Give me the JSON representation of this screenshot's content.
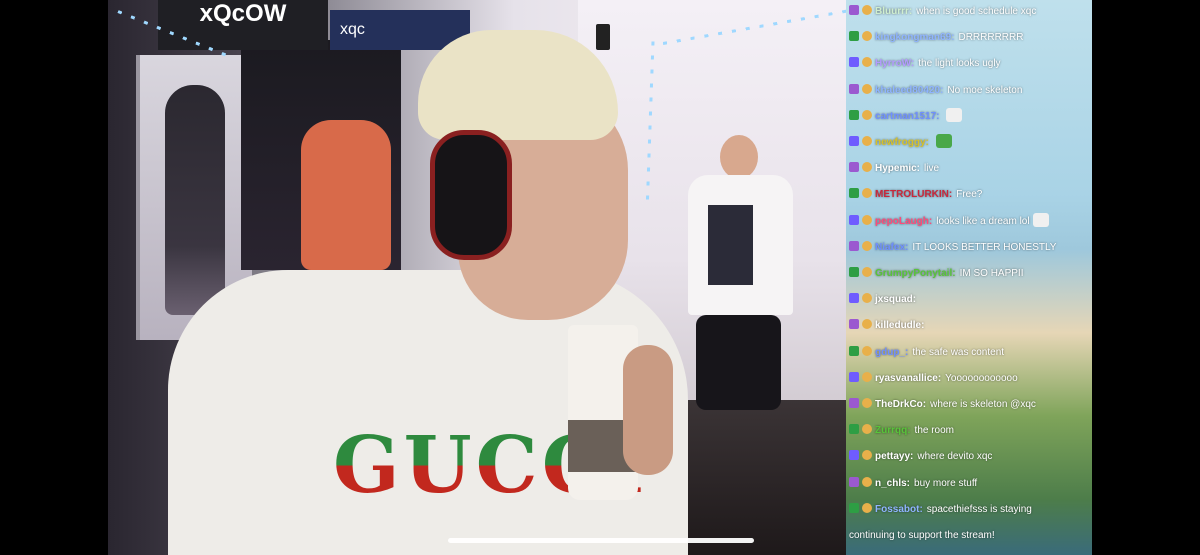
{
  "stream": {
    "banner_text": "xQcOW",
    "banner_text_2": "xqc",
    "shirt_text": "GUCCI"
  },
  "chat": {
    "messages": [
      {
        "user": "Bluurrr:",
        "text": "when is good schedule xqc",
        "user_color": "#cfeecf"
      },
      {
        "user": "kingkongman69:",
        "text": "DRRRRRRRR",
        "user_color": "#8fb4ff"
      },
      {
        "user": "HyrroW:",
        "text": "the light looks ugly",
        "user_color": "#b49cff"
      },
      {
        "user": "khaleed80420:",
        "text": "No moe skeleton",
        "user_color": "#8fb4ff"
      },
      {
        "user": "cartman1517:",
        "text": "",
        "user_color": "#6f8fff"
      },
      {
        "user": "newfroggy:",
        "text": "",
        "user_color": "#d7c22a"
      },
      {
        "user": "Hypemic:",
        "text": "live",
        "user_color": "#ffffff"
      },
      {
        "user": "METROLURKIN:",
        "text": "Free?",
        "user_color": "#c8283c"
      },
      {
        "user": "pepoLaugh:",
        "text": "looks like a dream lol",
        "user_color": "#ff4a7a"
      },
      {
        "user": "Niafex:",
        "text": "IT LOOKS BETTER HONESTLY",
        "user_color": "#6f8fff"
      },
      {
        "user": "GrumpyPonytail:",
        "text": "IM SO HAPPII",
        "user_color": "#58c43a"
      },
      {
        "user": "jxsquad:",
        "text": "",
        "user_color": "#ffffff"
      },
      {
        "user": "killedudle:",
        "text": "",
        "user_color": "#ffffff"
      },
      {
        "user": "gdup_:",
        "text": "the safe was content",
        "user_color": "#6f8fff"
      },
      {
        "user": "ryasvanallice:",
        "text": "Yoooooooooooo",
        "user_color": "#ffffff"
      },
      {
        "user": "TheDrkCo:",
        "text": "where is skeleton @xqc",
        "user_color": "#ffffff"
      },
      {
        "user": "Zurrqq:",
        "text": "the room",
        "user_color": "#58c43a"
      },
      {
        "user": "pettayy:",
        "text": "where devito xqc",
        "user_color": "#ffffff"
      },
      {
        "user": "n_chls:",
        "text": "buy more stuff",
        "user_color": "#ffffff"
      },
      {
        "user": "Fossabot:",
        "text": "spacethiefsss is staying",
        "user_color": "#8fb4ff"
      },
      {
        "user": "",
        "text": "continuing to support the stream!",
        "user_color": "#ffffff"
      }
    ]
  },
  "colors": {
    "badge_sub": "#9b59d0",
    "badge_mod": "#2e9e44",
    "badge_verified": "#6f5cff"
  }
}
